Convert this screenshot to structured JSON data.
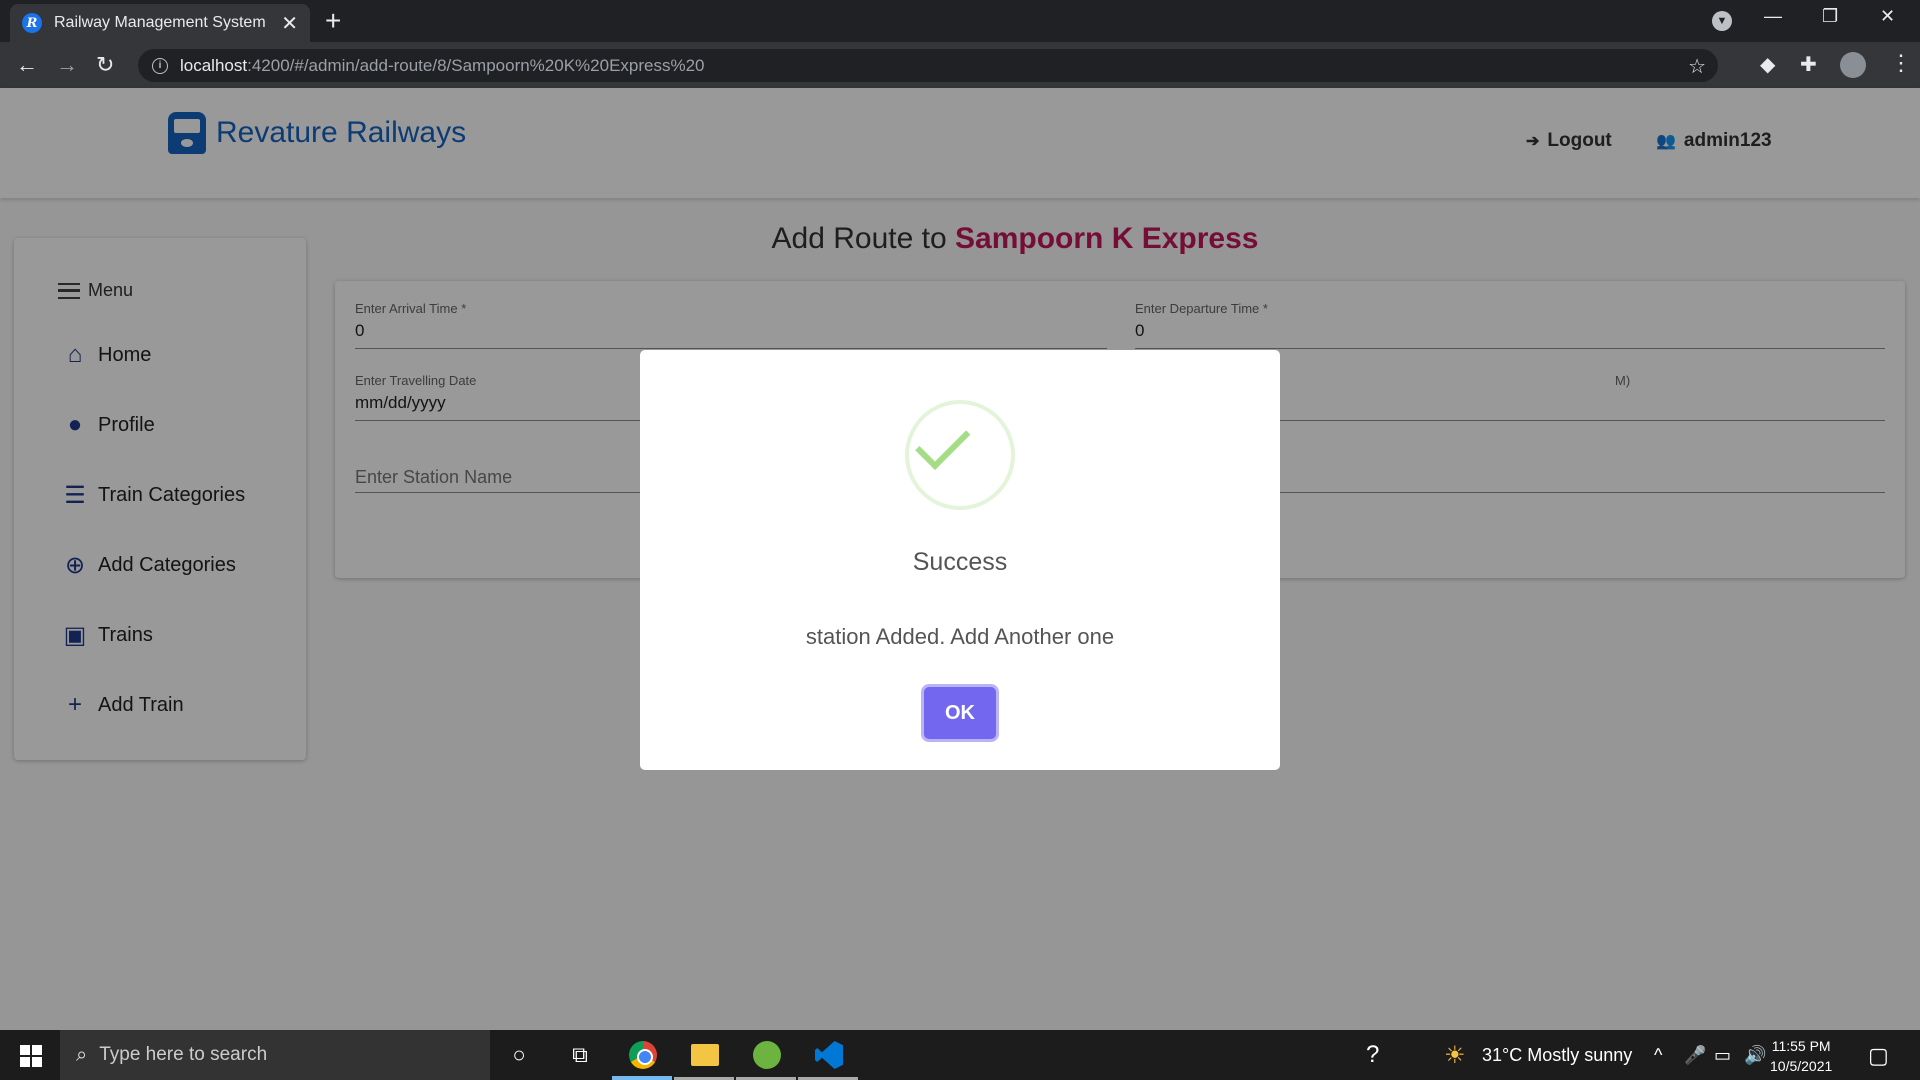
{
  "browser": {
    "tab_title": "Railway Management System",
    "tab_favicon_letter": "R",
    "url_host": "localhost",
    "url_rest": ":4200/#/admin/add-route/8/Sampoorn%20K%20Express%20"
  },
  "header": {
    "brand": "Revature Railways",
    "logout_label": "Logout",
    "user_label": "admin123"
  },
  "sidebar": {
    "menu_label": "Menu",
    "items": [
      {
        "label": "Home",
        "icon": "home-icon"
      },
      {
        "label": "Profile",
        "icon": "profile-icon"
      },
      {
        "label": "Train Categories",
        "icon": "list-icon"
      },
      {
        "label": "Add Categories",
        "icon": "add-circle-icon"
      },
      {
        "label": "Trains",
        "icon": "train-icon"
      },
      {
        "label": "Add Train",
        "icon": "plus-icon"
      }
    ]
  },
  "main": {
    "title_prefix": "Add Route to",
    "train_name": "Sampoorn K Express",
    "form": {
      "arrival_label": "Enter Arrival Time *",
      "arrival_value": "0",
      "departure_label": "Enter Departure Time *",
      "departure_value": "0",
      "date_label": "Enter Travelling Date",
      "date_value": "mm/dd/yyyy",
      "partial_label_fragment": "M)",
      "station_placeholder": "Enter Station Name"
    }
  },
  "modal": {
    "title": "Success",
    "message": "station Added. Add Another one",
    "ok_label": "OK"
  },
  "taskbar": {
    "search_placeholder": "Type here to search",
    "weather": "31°C  Mostly sunny",
    "time": "11:55 PM",
    "date": "10/5/2021"
  },
  "colors": {
    "brand": "#1565c0",
    "train_name": "#c2185b",
    "ok_button": "#7367f0",
    "success_check": "#a5dc86"
  }
}
